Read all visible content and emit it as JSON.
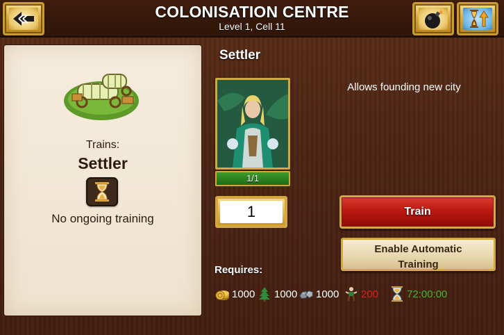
{
  "header": {
    "title": "COLONISATION CENTRE",
    "subtitle": "Level 1, Cell 11",
    "back_icon": "back-arrow-icon",
    "bomb_icon": "bomb-icon",
    "upgrade_icon": "upgrade-hourglass-icon"
  },
  "building": {
    "icon": "settler-wagon-icon",
    "trains_label": "Trains:",
    "trains_unit": "Settler",
    "status_icon": "hourglass-icon",
    "status": "No ongoing training"
  },
  "unit": {
    "name": "Settler",
    "description": "Allows founding new city",
    "count": "1/1",
    "quantity": "1"
  },
  "actions": {
    "train_label": "Train",
    "auto_label_line1": "Enable Automatic",
    "auto_label_line2": "Training"
  },
  "requirements": {
    "label": "Requires:",
    "gold": "1000",
    "wood": "1000",
    "iron": "1000",
    "population": "200",
    "time": "72:00:00"
  },
  "colors": {
    "background": "#4a2413",
    "gold_border": "#d4a83c",
    "train_button": "#b8160f",
    "insufficient": "#e31b1b",
    "time": "#3cb82e"
  }
}
